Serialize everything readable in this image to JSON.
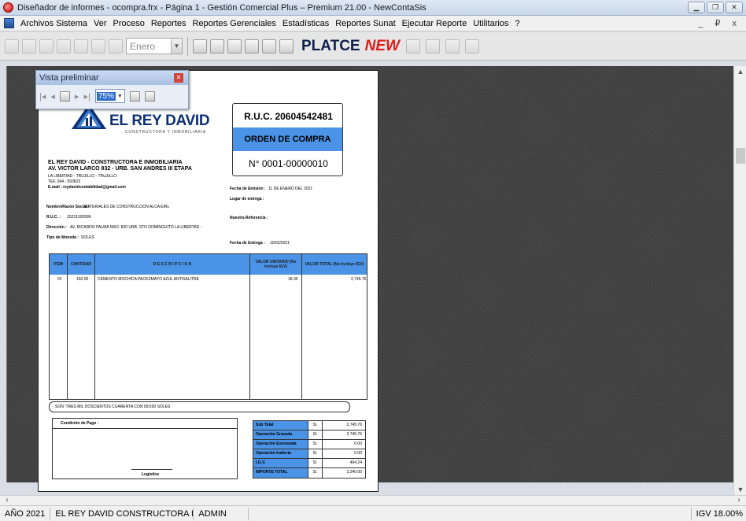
{
  "window": {
    "title": "Diseñador de informes - ocompra.frx - Página 1 - Gestión Comercial Plus – Premium 21.00 - NewContaSis",
    "buttons": [
      "minimize",
      "restore",
      "close"
    ]
  },
  "menu": {
    "items": [
      "Archivos Sistema",
      "Ver",
      "Proceso",
      "Reportes",
      "Reportes Gerenciales",
      "Estadísticas",
      "Reportes Sunat",
      "Ejecutar Reporte",
      "Utilitarios",
      "?"
    ],
    "mdi_controls": "_ ₽ x"
  },
  "toolbar": {
    "month_value": "Enero",
    "brand": "PLATCE",
    "badge": "NEW"
  },
  "preview": {
    "title": "Vista preliminar",
    "zoom": "75%",
    "nav": [
      "|◂",
      "◂",
      "▸",
      "▸|"
    ]
  },
  "report": {
    "company_logo_name": "EL REY DAVID",
    "company_logo_sub": "CONSTRUCTORA Y INMOBILIARIA",
    "ruc": "R.U.C. 20604542481",
    "doc_type": "ORDEN DE COMPRA",
    "doc_number": "N° 0001-00000010",
    "company_name": "EL REY DAVID - CONSTRUCTORA E INMOBILIARIA",
    "company_address": "AV. VICTOR LARCO 832 - URB. SAN ANDRES III ETAPA",
    "company_city": "LA LIBERTAD - TRUJILLO - TRUJILLO",
    "company_phone": "TEF. 044 - 593823",
    "company_email": "E.mail : reydavidcontabilidad@gmail.com",
    "supplier_label": "Nombre/Razón Social :",
    "supplier_value": "MATERIALES DE CONSTRUCCION ALCA EIRL",
    "ruc_label": "R.U.C. :",
    "ruc_value": "20231020999",
    "address_label": "Dirección :",
    "address_value": "AV. RICARDO PALMA NRO. 830 URB. STO DOMINGUITO LA LIBERTAD -",
    "currency_label": "Tipo de Moneda :",
    "currency_value": "SOLES",
    "emission_label": "Fecha de Emisión :",
    "emission_value": "11 DE ENERO DEL 2021",
    "delivery_place_label": "Lugar de entrega :",
    "reference_label": "Nuestra Referencia :",
    "delivery_date_label": "Fecha de Entrega :",
    "delivery_date_value": "10/02/2021",
    "table_headers": [
      "ITEM",
      "CANTIDAD",
      "D E S C R I P C I O N",
      "VALOR UNITARIO (No incluye IGV)",
      "VALOR TOTAL (No Incluye IGV)"
    ],
    "rows": [
      {
        "item": "01",
        "qty": "150.00",
        "desc": "CEMENTO MOCHICA PACKSMAYO AZUL ANTISALITRE",
        "unit": "18.30",
        "total": "2,745.76"
      }
    ],
    "amount_words": "SON: TRES MIL DOSCIENTOS CUARENTA CON 00/100 SOLES",
    "payment_condition_label": "Condición de Pago :",
    "signature_label": "Logística",
    "totals": [
      {
        "label": "Sub Total",
        "cur": "S/.",
        "value": "2,745.76"
      },
      {
        "label": "Operación Gravada",
        "cur": "S/.",
        "value": "2,745.76"
      },
      {
        "label": "Operación Exonerada",
        "cur": "S/.",
        "value": "0.00"
      },
      {
        "label": "Operación Inafecta",
        "cur": "S/.",
        "value": "0.00"
      },
      {
        "label": "I.G.V.",
        "cur": "S/.",
        "value": "494.24"
      },
      {
        "label": "IMPORTE TOTAL",
        "cur": "S/.",
        "value": "3,240.00"
      }
    ]
  },
  "status": {
    "year": "AÑO 2021",
    "company": "EL REY DAVID CONSTRUCTORA E INMOBILI/",
    "user": "ADMIN",
    "igv": "IGV 18.00%"
  }
}
